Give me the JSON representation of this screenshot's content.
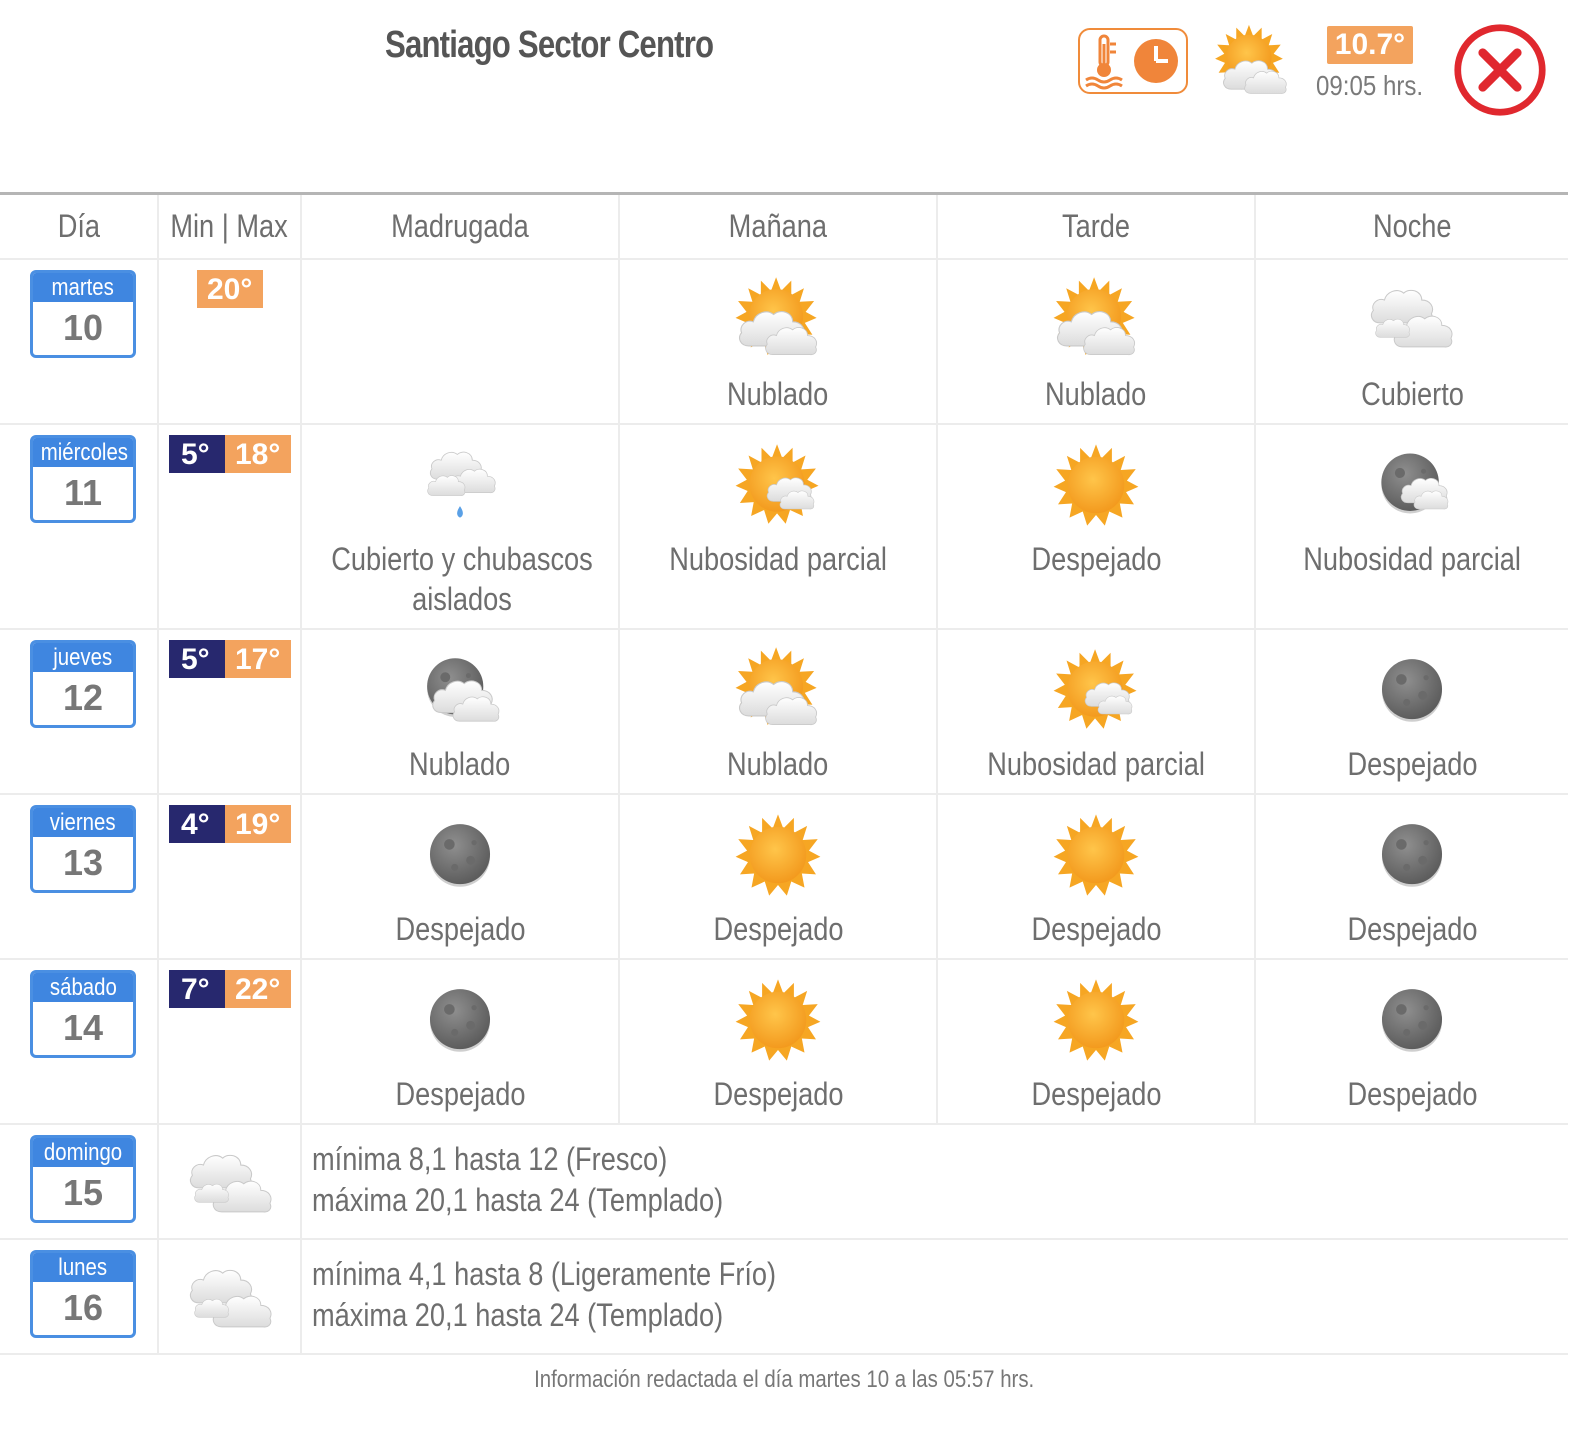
{
  "header": {
    "title": "Santiago Sector Centro",
    "current_temp": "10.7°",
    "current_time": "09:05 hrs.",
    "current_icon": "sun-cloud-icon",
    "toggle_icon": "thermometer-clock-icon",
    "close_icon": "close-icon"
  },
  "columns": {
    "day": "Día",
    "minmax": "Min | Max",
    "madrugada": "Madrugada",
    "manana": "Mañana",
    "tarde": "Tarde",
    "noche": "Noche"
  },
  "days": [
    {
      "weekday": "martes",
      "date": "10",
      "min": "",
      "max": "20°",
      "periods": [
        {
          "icon": "",
          "label": ""
        },
        {
          "icon": "sun-cloud",
          "label": "Nublado"
        },
        {
          "icon": "sun-cloud",
          "label": "Nublado"
        },
        {
          "icon": "clouds",
          "label": "Cubierto"
        }
      ]
    },
    {
      "weekday": "miércoles",
      "date": "11",
      "min": "5°",
      "max": "18°",
      "periods": [
        {
          "icon": "cloud-rain",
          "label": "Cubierto y chubascos aislados"
        },
        {
          "icon": "sun-cloud-small",
          "label": "Nubosidad parcial"
        },
        {
          "icon": "sun",
          "label": "Despejado"
        },
        {
          "icon": "moon-cloud",
          "label": "Nubosidad parcial"
        }
      ]
    },
    {
      "weekday": "jueves",
      "date": "12",
      "min": "5°",
      "max": "17°",
      "periods": [
        {
          "icon": "moon-cloud-big",
          "label": "Nublado"
        },
        {
          "icon": "sun-cloud",
          "label": "Nublado"
        },
        {
          "icon": "sun-cloud-small",
          "label": "Nubosidad parcial"
        },
        {
          "icon": "moon",
          "label": "Despejado"
        }
      ]
    },
    {
      "weekday": "viernes",
      "date": "13",
      "min": "4°",
      "max": "19°",
      "periods": [
        {
          "icon": "moon",
          "label": "Despejado"
        },
        {
          "icon": "sun",
          "label": "Despejado"
        },
        {
          "icon": "sun",
          "label": "Despejado"
        },
        {
          "icon": "moon",
          "label": "Despejado"
        }
      ]
    },
    {
      "weekday": "sábado",
      "date": "14",
      "min": "7°",
      "max": "22°",
      "periods": [
        {
          "icon": "moon",
          "label": "Despejado"
        },
        {
          "icon": "sun",
          "label": "Despejado"
        },
        {
          "icon": "sun",
          "label": "Despejado"
        },
        {
          "icon": "moon",
          "label": "Despejado"
        }
      ]
    }
  ],
  "extended": [
    {
      "weekday": "domingo",
      "date": "15",
      "icon": "clouds",
      "line1": "mínima 8,1 hasta 12 (Fresco)",
      "line2": "máxima 20,1 hasta 24 (Templado)"
    },
    {
      "weekday": "lunes",
      "date": "16",
      "icon": "clouds",
      "line1": "mínima 4,1 hasta 8 (Ligeramente Frío)",
      "line2": "máxima 20,1 hasta 24 (Templado)"
    }
  ],
  "footer": "Información redactada el día martes 10 a las 05:57 hrs.",
  "colors": {
    "accent_orange": "#f3a35e",
    "min_navy": "#27286e",
    "calendar_blue": "#3f86e0",
    "close_red": "#e0282e"
  }
}
